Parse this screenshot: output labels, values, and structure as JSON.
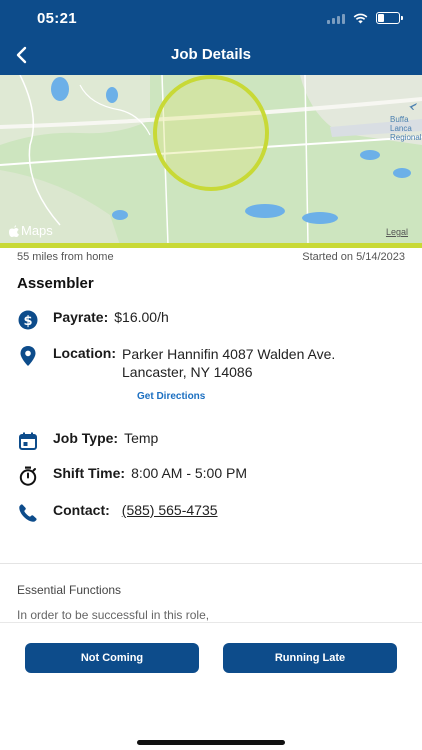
{
  "status_bar": {
    "time": "05:21"
  },
  "header": {
    "title": "Job Details"
  },
  "map": {
    "maps_label": "Maps",
    "legal_label": "Legal",
    "airport_label": "Buffa\nLanca\nRegional A"
  },
  "job": {
    "distance": "55 miles from home",
    "started": "Started on 5/14/2023",
    "title": "Assembler",
    "payrate_label": "Payrate:",
    "payrate_value": "$16.00/h",
    "location_label": "Location:",
    "location_line1": "Parker Hannifin 4087 Walden Ave.",
    "location_line2": "Lancaster, NY 14086",
    "directions_label": "Get Directions",
    "jobtype_label": "Job Type:",
    "jobtype_value": "Temp",
    "shift_label": "Shift Time:",
    "shift_value": "8:00 AM - 5:00 PM",
    "contact_label": "Contact:",
    "contact_value": "(585) 565-4735"
  },
  "essential": {
    "title": "Essential Functions",
    "text": "In order to be successful in this role,"
  },
  "actions": {
    "not_coming": "Not Coming",
    "running_late": "Running Late"
  },
  "colors": {
    "brand": "#0d4c8b",
    "link": "#1b6fc1",
    "map_ring": "#c8d936"
  }
}
